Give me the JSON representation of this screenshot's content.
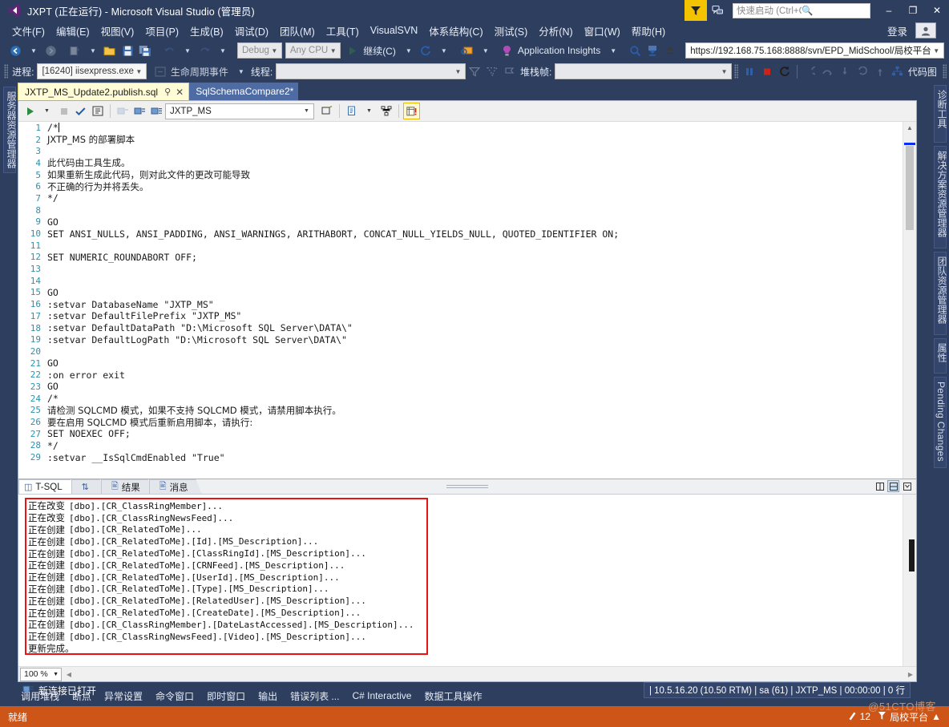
{
  "window": {
    "title": "JXPT (正在运行) - Microsoft Visual Studio (管理员)",
    "logo_icon": "visual-studio-logo",
    "minimize_label": "–",
    "maximize_label": "❐",
    "close_label": "✕"
  },
  "titlebar": {
    "feedback_icon": "feedback-funnel-icon",
    "feedback_alt_icon": "send-feedback-icon",
    "quick_launch_placeholder": "快速启动 (Ctrl+Q)",
    "quick_launch_value": "",
    "search_icon": "search-icon"
  },
  "menu": {
    "items": [
      "文件(F)",
      "编辑(E)",
      "视图(V)",
      "项目(P)",
      "生成(B)",
      "调试(D)",
      "团队(M)",
      "工具(T)",
      "VisualSVN",
      "体系结构(C)",
      "测试(S)",
      "分析(N)",
      "窗口(W)",
      "帮助(H)"
    ],
    "signin_label": "登录",
    "account_icon": "account-icon"
  },
  "toolbar_main": {
    "nav_back_icon": "navigate-back-icon",
    "nav_forward_icon": "navigate-forward-icon",
    "new_project_icon": "new-project-icon",
    "open_file_icon": "open-file-icon",
    "save_icon": "save-icon",
    "save_all_icon": "save-all-icon",
    "undo_icon": "undo-icon",
    "redo_icon": "redo-icon",
    "config_value": "Debug",
    "platform_value": "Any CPU",
    "continue_label": "继续(C)",
    "continue_icon": "play-icon",
    "restart_icon": "restart-icon",
    "attach_icon": "attach-to-process-icon",
    "app_insights_label": "Application Insights",
    "app_insights_icon": "lightbulb-icon",
    "find_icon": "find-in-files-icon",
    "download_icon": "download-icon",
    "upload_icon": "upload-icon",
    "repo_url": "https://192.168.75.168:8888/svn/EPD_MidSchool/局校平台"
  },
  "toolbar_debug": {
    "process_label": "进程:",
    "process_value": "[16240] iisexpress.exe",
    "lifecycle_icon": "lifecycle-events-icon",
    "lifecycle_label": "生命周期事件",
    "thread_label": "线程:",
    "thread_value": "",
    "filter_icon": "filter-icon",
    "filter2_icon": "filter-clear-icon",
    "flag_icon": "flag-icon",
    "stackframe_label": "堆栈帧:",
    "stackframe_value": "",
    "pause_icon": "pause-icon",
    "stop_icon": "stop-icon",
    "restart_icon": "restart-debug-icon",
    "step_over_icon": "step-over-icon",
    "step_into_icon": "step-into-icon",
    "step_out_icon": "step-out-icon",
    "step_back_icon": "step-back-icon",
    "step_fwd_icon": "step-forward-icon",
    "codemap_icon": "code-map-icon",
    "codemap_label": "代码图"
  },
  "left_rail": {
    "tabs": [
      "服务器资源管理器"
    ]
  },
  "right_rail": {
    "tabs": [
      "诊断工具",
      "解决方案资源管理器",
      "团队资源管理器",
      "属性",
      "Pending Changes"
    ]
  },
  "document_tabs": [
    {
      "label": "JXTP_MS_Update2.publish.sql",
      "active": true,
      "pin_icon": "pin-icon",
      "close_icon": "close-icon"
    },
    {
      "label": "SqlSchemaCompare2*",
      "active": false
    }
  ],
  "editor_toolbar": {
    "execute_icon": "execute-query-icon",
    "stop_icon": "stop-query-icon",
    "parse_icon": "parse-check-icon",
    "plan_icon": "execution-plan-icon",
    "db_icon1": "database-icon-1",
    "db_icon2": "database-icon-2",
    "db_icon3": "database-icon-3",
    "database_value": "JXTP_MS",
    "connect_icon": "connect-icon",
    "new_query_icon": "new-query-icon",
    "schema_icon": "schema-compare-icon",
    "results_icon": "results-to-grid-icon"
  },
  "editor": {
    "zoom": "100 %",
    "lines": [
      {
        "n": 1,
        "text": "/*",
        "cn": false
      },
      {
        "n": 2,
        "text": "JXTP_MS 的部署脚本",
        "cn": true
      },
      {
        "n": 3,
        "text": "",
        "cn": false
      },
      {
        "n": 4,
        "text": "此代码由工具生成。",
        "cn": true
      },
      {
        "n": 5,
        "text": "如果重新生成此代码，则对此文件的更改可能导致",
        "cn": true
      },
      {
        "n": 6,
        "text": "不正确的行为并将丢失。",
        "cn": true
      },
      {
        "n": 7,
        "text": "*/",
        "cn": false
      },
      {
        "n": 8,
        "text": "",
        "cn": false
      },
      {
        "n": 9,
        "text": "GO",
        "cn": false
      },
      {
        "n": 10,
        "text": "SET ANSI_NULLS, ANSI_PADDING, ANSI_WARNINGS, ARITHABORT, CONCAT_NULL_YIELDS_NULL, QUOTED_IDENTIFIER ON;",
        "cn": false
      },
      {
        "n": 11,
        "text": "",
        "cn": false
      },
      {
        "n": 12,
        "text": "SET NUMERIC_ROUNDABORT OFF;",
        "cn": false
      },
      {
        "n": 13,
        "text": "",
        "cn": false
      },
      {
        "n": 14,
        "text": "",
        "cn": false
      },
      {
        "n": 15,
        "text": "GO",
        "cn": false
      },
      {
        "n": 16,
        "text": ":setvar DatabaseName \"JXTP_MS\"",
        "cn": false
      },
      {
        "n": 17,
        "text": ":setvar DefaultFilePrefix \"JXTP_MS\"",
        "cn": false
      },
      {
        "n": 18,
        "text": ":setvar DefaultDataPath \"D:\\Microsoft SQL Server\\DATA\\\"",
        "cn": false
      },
      {
        "n": 19,
        "text": ":setvar DefaultLogPath \"D:\\Microsoft SQL Server\\DATA\\\"",
        "cn": false
      },
      {
        "n": 20,
        "text": "",
        "cn": false
      },
      {
        "n": 21,
        "text": "GO",
        "cn": false
      },
      {
        "n": 22,
        "text": ":on error exit",
        "cn": false
      },
      {
        "n": 23,
        "text": "GO",
        "cn": false
      },
      {
        "n": 24,
        "text": "/*",
        "cn": false
      },
      {
        "n": 25,
        "text": "请检测 SQLCMD 模式，如果不支持 SQLCMD 模式，请禁用脚本执行。",
        "cn": true
      },
      {
        "n": 26,
        "text": "要在启用 SQLCMD 模式后重新启用脚本，请执行:",
        "cn": true
      },
      {
        "n": 27,
        "text": "SET NOEXEC OFF;",
        "cn": false
      },
      {
        "n": 28,
        "text": "*/",
        "cn": false
      },
      {
        "n": 29,
        "text": ":setvar __IsSqlCmdEnabled \"True\"",
        "cn": false
      }
    ]
  },
  "output_pane": {
    "tabs": [
      {
        "label": "T-SQL",
        "icon": "tsql-icon",
        "active": true
      },
      {
        "label": "",
        "icon": "sort-icon",
        "active": false
      },
      {
        "label": "结果",
        "icon": "results-icon",
        "active": false
      },
      {
        "label": "消息",
        "icon": "messages-icon",
        "active": false
      }
    ],
    "tools": [
      {
        "icon": "split-vertical-icon",
        "active": false
      },
      {
        "icon": "split-horizontal-icon",
        "active": true
      },
      {
        "icon": "maximize-results-icon",
        "active": false
      }
    ],
    "zoom": "100 %",
    "lines": [
      {
        "action": "正在改变",
        "target": "[dbo].[CR_ClassRingMember]..."
      },
      {
        "action": "正在改变",
        "target": "[dbo].[CR_ClassRingNewsFeed]..."
      },
      {
        "action": "正在创建",
        "target": "[dbo].[CR_RelatedToMe]..."
      },
      {
        "action": "正在创建",
        "target": "[dbo].[CR_RelatedToMe].[Id].[MS_Description]..."
      },
      {
        "action": "正在创建",
        "target": "[dbo].[CR_RelatedToMe].[ClassRingId].[MS_Description]..."
      },
      {
        "action": "正在创建",
        "target": "[dbo].[CR_RelatedToMe].[CRNFeed].[MS_Description]..."
      },
      {
        "action": "正在创建",
        "target": "[dbo].[CR_RelatedToMe].[UserId].[MS_Description]..."
      },
      {
        "action": "正在创建",
        "target": "[dbo].[CR_RelatedToMe].[Type].[MS_Description]..."
      },
      {
        "action": "正在创建",
        "target": "[dbo].[CR_RelatedToMe].[RelatedUser].[MS_Description]..."
      },
      {
        "action": "正在创建",
        "target": "[dbo].[CR_RelatedToMe].[CreateDate].[MS_Description]..."
      },
      {
        "action": "正在创建",
        "target": "[dbo].[CR_ClassRingMember].[DateLastAccessed].[MS_Description]..."
      },
      {
        "action": "正在创建",
        "target": "[dbo].[CR_ClassRingNewsFeed].[Video].[MS_Description]..."
      },
      {
        "action": "更新完成。",
        "target": ""
      }
    ]
  },
  "connection_bar": {
    "icon": "connection-icon",
    "label": "新连接已打开",
    "server_version": "10.5.16.20 (10.50 RTM)",
    "user": "sa (61)",
    "database": "JXTP_MS",
    "elapsed": "00:00:00",
    "rows": "0 行"
  },
  "bottom_tool_tabs": [
    "调用堆栈",
    "断点",
    "异常设置",
    "命令窗口",
    "即时窗口",
    "输出",
    "错误列表 ...",
    "C# Interactive",
    "数据工具操作"
  ],
  "statusbar": {
    "state": "就绪",
    "pending_icon": "pending-changes-icon",
    "pending_count": "12",
    "branch_icon": "branch-icon",
    "branch": "局校平台",
    "branch_caret": "▲",
    "watermark": "@51CTO博客"
  }
}
